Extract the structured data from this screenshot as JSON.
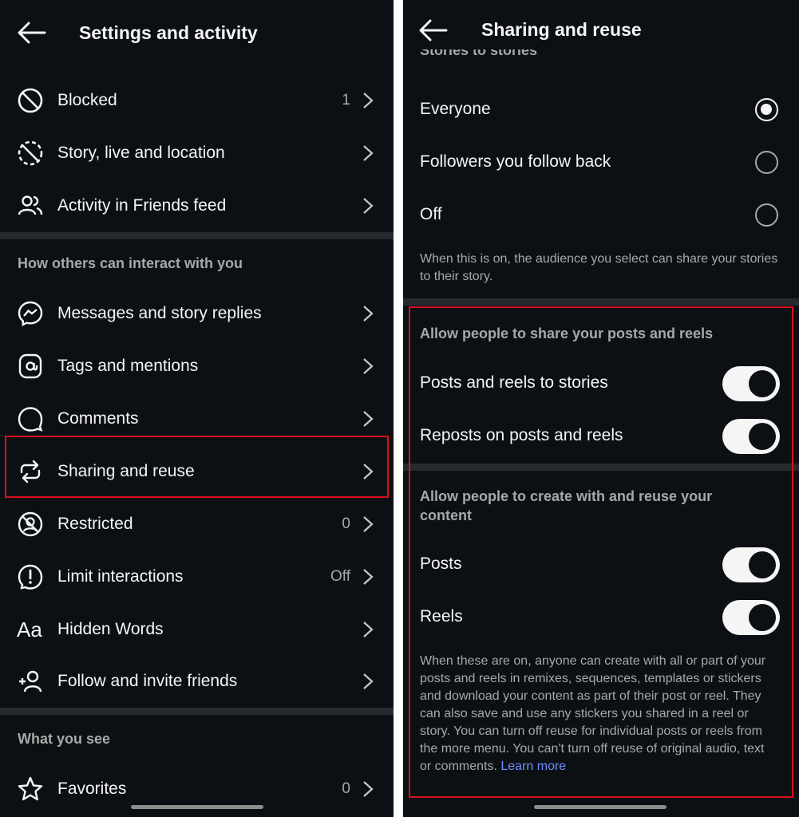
{
  "left": {
    "title": "Settings and activity",
    "rows_top": [
      {
        "label": "Blocked",
        "value": "1",
        "icon": "block-icon"
      },
      {
        "label": "Story, live and location",
        "value": "",
        "icon": "story-off-icon"
      },
      {
        "label": "Activity in Friends feed",
        "value": "",
        "icon": "friends-icon"
      }
    ],
    "section1_title": "How others can interact with you",
    "rows_interact": [
      {
        "label": "Messages and story replies",
        "value": "",
        "icon": "messenger-icon"
      },
      {
        "label": "Tags and mentions",
        "value": "",
        "icon": "at-icon"
      },
      {
        "label": "Comments",
        "value": "",
        "icon": "comment-icon"
      },
      {
        "label": "Sharing and reuse",
        "value": "",
        "icon": "sharing-icon"
      },
      {
        "label": "Restricted",
        "value": "0",
        "icon": "restricted-icon"
      },
      {
        "label": "Limit interactions",
        "value": "Off",
        "icon": "limit-icon"
      },
      {
        "label": "Hidden Words",
        "value": "",
        "icon": "hidden-words-icon",
        "glyph": "Aa"
      },
      {
        "label": "Follow and invite friends",
        "value": "",
        "icon": "add-person-icon"
      }
    ],
    "section2_title": "What you see",
    "rows_see": [
      {
        "label": "Favorites",
        "value": "0",
        "icon": "star-icon"
      }
    ]
  },
  "right": {
    "title": "Sharing and reuse",
    "clipped_section_title": "Stories to stories",
    "radios": [
      {
        "label": "Everyone",
        "selected": true
      },
      {
        "label": "Followers you follow back",
        "selected": false
      },
      {
        "label": "Off",
        "selected": false
      }
    ],
    "stories_desc": "When this is on, the audience you select can share your stories to their story.",
    "posts_section_title": "Allow people to share your posts and reels",
    "posts_toggles": [
      {
        "label": "Posts and reels to stories",
        "on": true
      },
      {
        "label": "Reposts on posts and reels",
        "on": true
      }
    ],
    "reuse_section_title": "Allow people to create with and reuse your content",
    "reuse_toggles": [
      {
        "label": "Posts",
        "on": true
      },
      {
        "label": "Reels",
        "on": true
      }
    ],
    "reuse_desc": "When these are on, anyone can create with all or part of your posts and reels in remixes, sequences, templates or stickers and download your content as part of their post or reel. They can also save and use any stickers you shared in a reel or story. You can turn off reuse for individual posts or reels from the more menu. You can't turn off reuse of original audio, text or comments.",
    "learn_more": "Learn more"
  },
  "colors": {
    "background": "#0c1014",
    "text": "#f5f5f5",
    "secondary": "#a8a8a8",
    "highlight": "#d9101d",
    "link": "#708dff"
  }
}
